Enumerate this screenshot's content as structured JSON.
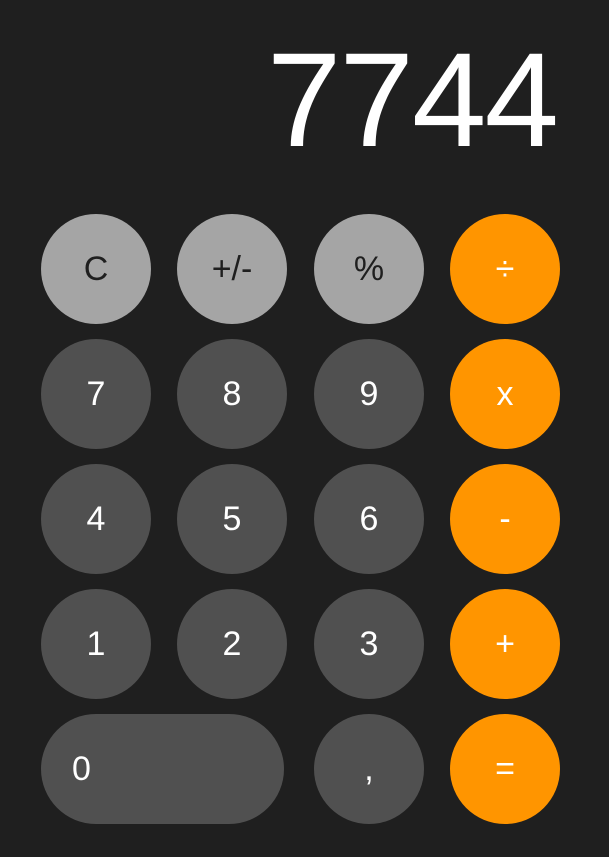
{
  "display": {
    "value": "7744"
  },
  "colors": {
    "background": "#1f1f1f",
    "function_key": "#a5a5a5",
    "number_key": "#505050",
    "operator_key": "#ff9500"
  },
  "keys": {
    "clear": "C",
    "plus_minus": "+/-",
    "percent": "%",
    "divide": "÷",
    "seven": "7",
    "eight": "8",
    "nine": "9",
    "multiply": "x",
    "four": "4",
    "five": "5",
    "six": "6",
    "minus": "-",
    "one": "1",
    "two": "2",
    "three": "3",
    "plus": "+",
    "zero": "0",
    "decimal": ",",
    "equals": "="
  }
}
